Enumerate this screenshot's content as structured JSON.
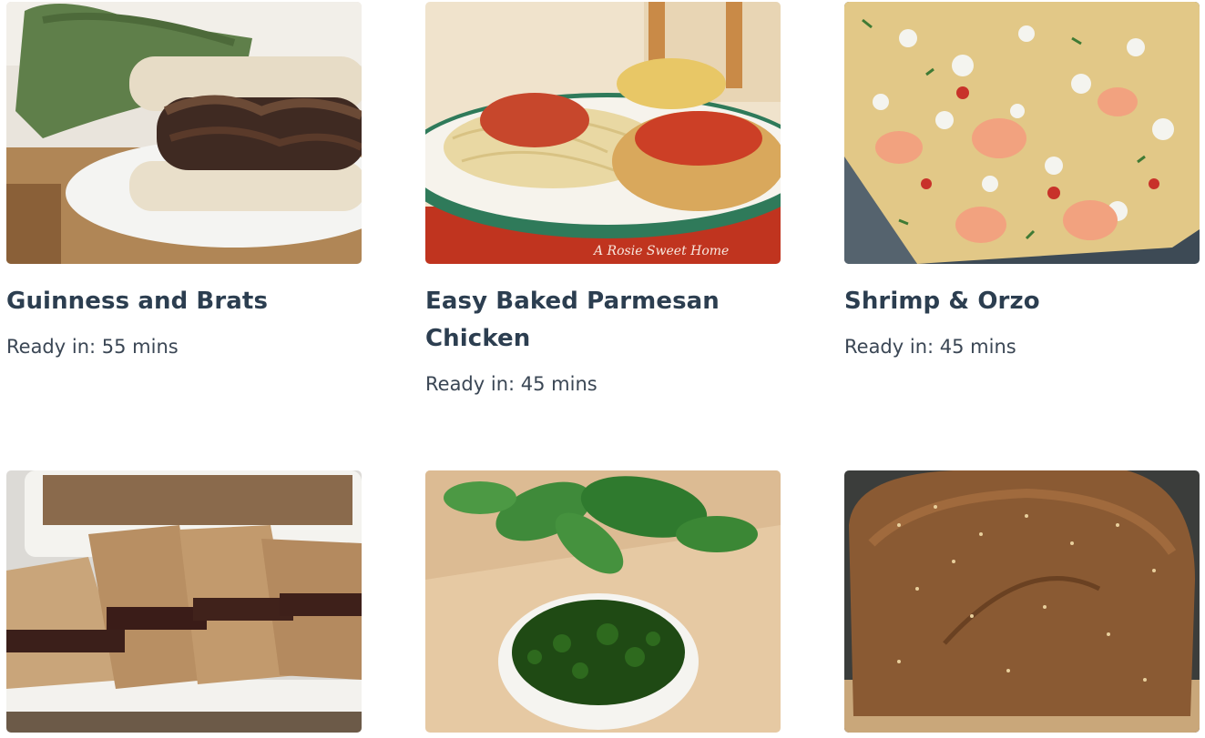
{
  "recipes": [
    {
      "title": "Guinness and Brats",
      "ready_label": "Ready in:",
      "ready_value": "55 mins",
      "image_icon": "sausage-sandwich-photo"
    },
    {
      "title": "Easy Baked Parmesan Chicken",
      "ready_label": "Ready in:",
      "ready_value": "45 mins",
      "image_icon": "parmesan-chicken-photo",
      "watermark": "A Rosie Sweet Home"
    },
    {
      "title": "Shrimp & Orzo",
      "ready_label": "Ready in:",
      "ready_value": "45 mins",
      "image_icon": "shrimp-orzo-photo"
    },
    {
      "title": "",
      "ready_label": "",
      "ready_value": "",
      "image_icon": "date-bars-photo"
    },
    {
      "title": "",
      "ready_label": "",
      "ready_value": "",
      "image_icon": "pesto-bowl-photo"
    },
    {
      "title": "",
      "ready_label": "",
      "ready_value": "",
      "image_icon": "bread-loaf-photo"
    }
  ],
  "colors": {
    "title": "#2c3e50",
    "text": "#3a4654",
    "background": "#ffffff"
  }
}
